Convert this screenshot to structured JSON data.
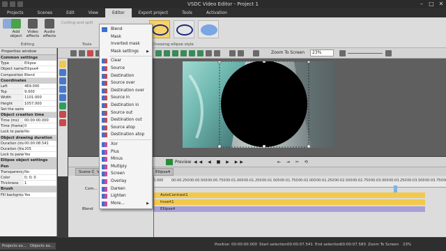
{
  "window": {
    "title": "VSDC Video Editor - Project 1",
    "controls": [
      "–",
      "□",
      "✕"
    ]
  },
  "menu": [
    "Projects",
    "Scenes",
    "Edit",
    "View",
    "Editor",
    "Export project",
    "Tools",
    "Activation"
  ],
  "active_menu": "Editor",
  "ribbon": {
    "buttons": [
      "Add object",
      "Video effects",
      "Audio effects"
    ],
    "cutting_label": "Cutting and split",
    "group_editing": "Editing",
    "group_tools": "Tools",
    "group_ellipse": "Choosing ellipse style"
  },
  "properties": {
    "title": "Properties window",
    "rows": [
      {
        "type": "sec",
        "k": "Common settings"
      },
      {
        "type": "row",
        "k": "Type",
        "v": "Ellipse"
      },
      {
        "type": "row",
        "k": "Object name",
        "v": "Ellipse4"
      },
      {
        "type": "row",
        "k": "Composition mode",
        "v": "Blend"
      },
      {
        "type": "sec",
        "k": "Coordinates"
      },
      {
        "type": "row",
        "k": "Left",
        "v": "469.000"
      },
      {
        "type": "row",
        "k": "Top",
        "v": "9.000"
      },
      {
        "type": "row",
        "k": "Width",
        "v": "1101.000"
      },
      {
        "type": "row",
        "k": "Height",
        "v": "1057.000"
      },
      {
        "type": "row",
        "k": "Set the same size as the parent has",
        "v": ""
      },
      {
        "type": "sec",
        "k": "Object creation time"
      },
      {
        "type": "row",
        "k": "Time (ms)",
        "v": "00:00:00.000"
      },
      {
        "type": "row",
        "k": "Time (frame)",
        "v": "0"
      },
      {
        "type": "row",
        "k": "Lock to parent",
        "v": "No"
      },
      {
        "type": "sec",
        "k": "Object drawing duration"
      },
      {
        "type": "row",
        "k": "Duration (ms)",
        "v": "00:00:08.541"
      },
      {
        "type": "row",
        "k": "Duration (frames)",
        "v": "205"
      },
      {
        "type": "row",
        "k": "Lock to parent",
        "v": "Yes"
      },
      {
        "type": "sec",
        "k": "Ellipse object settings"
      },
      {
        "type": "sec",
        "k": "Pen"
      },
      {
        "type": "row",
        "k": "Transparency",
        "v": "No"
      },
      {
        "type": "row",
        "k": "Color",
        "v": "0; 0; 0"
      },
      {
        "type": "row",
        "k": "Thickness",
        "v": "1"
      },
      {
        "type": "sec",
        "k": "Brush"
      },
      {
        "type": "row",
        "k": "Fill background",
        "v": "Yes"
      }
    ]
  },
  "toolbar": {
    "zoom_label": "Zoom To Screen",
    "zoom_value": "23%"
  },
  "timeline": {
    "preview_label": "Preview",
    "tabs": [
      "Scene 0",
      "Vi",
      "Ellipse4"
    ],
    "com_label": "Com...",
    "ruler": [
      "0.000",
      "00:00.250",
      "00:00.500",
      "00:00.750",
      "00:01.000",
      "00:01.250",
      "00:01.500",
      "00:01.750",
      "00:02.000",
      "00:02.250",
      "00:02.500",
      "00:02.750",
      "00:03.000",
      "00:03.250",
      "00:03.500",
      "00:03.750",
      "00:04.000",
      "00:04.250",
      "00:04.500",
      "00:04.750",
      "00:05.000"
    ],
    "ruler_shown": [
      "0.000",
      "00:00.250",
      "00:00.500",
      "00:00.750",
      "00:01.000",
      "00:01.250",
      "00:01.500",
      "00:01.750",
      "00:02.000",
      "00:02.250",
      "00:02.500",
      "00:02.750",
      "00:03.000",
      "00:03.250",
      "00:03.500",
      "00:03.750",
      "00:04.000",
      "00:04.250",
      "00:04.500",
      "00:04.750",
      "00:05.000"
    ],
    "tracks": [
      {
        "name": "AutoContrast1",
        "color": "#f2c94c"
      },
      {
        "name": "Invert1",
        "color": "#f2c94c"
      },
      {
        "name": "Ellipse4",
        "color": "#a9a0d8"
      }
    ],
    "blend_label": "Blend"
  },
  "bottom_tabs": [
    "Projects ex...",
    "Objects ex..."
  ],
  "status": {
    "position_label": "Position",
    "position": "00:00:00.000",
    "start_label": "Start selection",
    "start": "00:00:07.541",
    "end_label": "End selection",
    "end": "00:00:07.583",
    "zoom_label": "Zoom To Screen",
    "zoom": "23%"
  },
  "context_menu": {
    "groups": [
      [
        {
          "label": "Blend",
          "checked": true
        },
        {
          "label": "Mask"
        },
        {
          "label": "Inverted mask"
        },
        {
          "label": "Mask settings",
          "submenu": true
        }
      ],
      [
        {
          "label": "Clear"
        },
        {
          "label": "Source"
        },
        {
          "label": "Destination"
        },
        {
          "label": "Source over"
        },
        {
          "label": "Destination over"
        },
        {
          "label": "Source in"
        },
        {
          "label": "Destination in"
        },
        {
          "label": "Source out"
        },
        {
          "label": "Destination out"
        },
        {
          "label": "Source atop"
        },
        {
          "label": "Destination atop"
        }
      ],
      [
        {
          "label": "Xor"
        },
        {
          "label": "Plus"
        },
        {
          "label": "Minus"
        },
        {
          "label": "Multiply"
        },
        {
          "label": "Screen"
        },
        {
          "label": "Overlay"
        },
        {
          "label": "Darken"
        },
        {
          "label": "Lighten"
        },
        {
          "label": "More...",
          "submenu": true
        }
      ]
    ]
  },
  "colors": {
    "accent": "#f5d36a",
    "dark": "#2b2b2b",
    "menu_active": "#d9d9d9",
    "playhead": "#d33333"
  }
}
